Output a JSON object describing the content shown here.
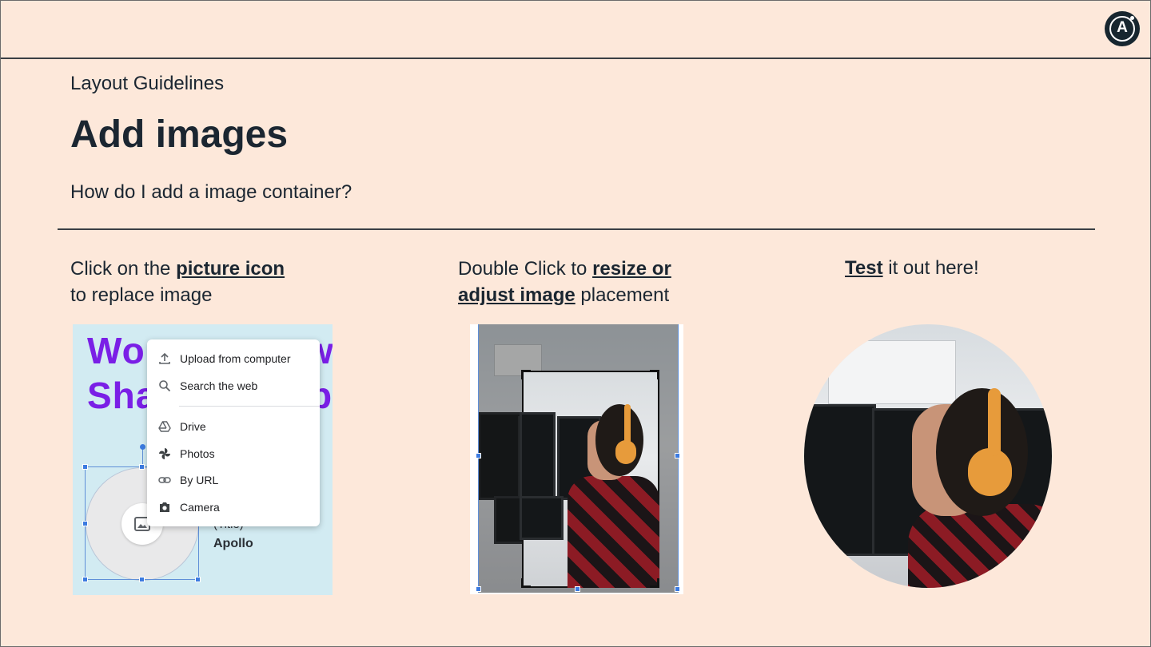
{
  "header": {
    "logo_letter": "A",
    "eyebrow": "Layout Guidelines",
    "title": "Add images",
    "subtitle": "How do I add a image container?"
  },
  "steps": [
    {
      "pre": "Click on the ",
      "link": "picture icon",
      "post": "",
      "line2": "to replace image"
    },
    {
      "pre": "Double Click to ",
      "link": "resize or",
      "link2": "adjust image",
      "post": " placement"
    },
    {
      "link": "Test",
      "post": " it out here!"
    }
  ],
  "panel1": {
    "headline_line1": "Wo",
    "headline_line1_tail": "w",
    "headline_line2": "Sha",
    "headline_line2_tail": "p",
    "caption_role": "(Title)",
    "caption_name": "Apollo",
    "menu": {
      "items": [
        {
          "icon": "upload-icon",
          "label": "Upload from computer"
        },
        {
          "icon": "search-icon",
          "label": "Search the web"
        },
        {
          "icon": "drive-icon",
          "label": "Drive"
        },
        {
          "icon": "photos-icon",
          "label": "Photos"
        },
        {
          "icon": "link-icon",
          "label": "By URL"
        },
        {
          "icon": "camera-icon",
          "label": "Camera"
        }
      ]
    }
  },
  "colors": {
    "background": "#fde8da",
    "text": "#1b2631",
    "accent_purple": "#7a1fe6",
    "selection_blue": "#3c7be0",
    "panel_blue": "#d2ebf2"
  }
}
